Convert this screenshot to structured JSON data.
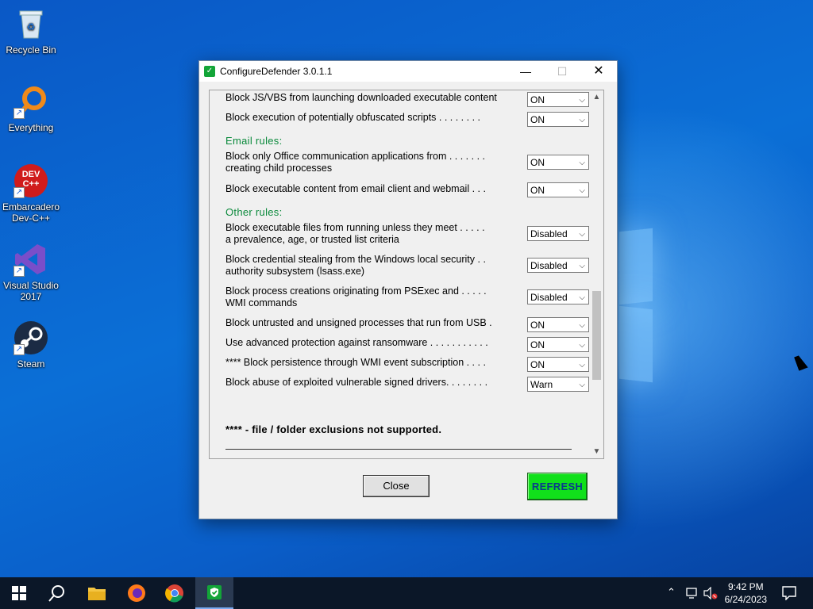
{
  "desktop": {
    "icons": [
      {
        "label": "Recycle Bin"
      },
      {
        "label": "Everything"
      },
      {
        "label": "Embarcadero Dev-C++"
      },
      {
        "label": "Visual Studio 2017"
      },
      {
        "label": "Steam"
      }
    ],
    "dev_cpp_icon_text": "DEV C++"
  },
  "window": {
    "title": "ConfigureDefender 3.0.1.1",
    "rules": [
      {
        "label": "Block JS/VBS from launching downloaded executable content",
        "value": "ON"
      },
      {
        "label": "Block execution of potentially obfuscated scripts . . . . . . . .",
        "value": "ON"
      }
    ],
    "email_section": "Email rules:",
    "email_rules": [
      {
        "label": "Block only Office communication applications from . . . . . . .",
        "label2": "creating child processes",
        "value": "ON"
      },
      {
        "label": "Block executable content from email client and webmail . . .",
        "value": "ON"
      }
    ],
    "other_section": "Other rules:",
    "other_rules": [
      {
        "label": "Block executable files from running unless they meet . . . . .",
        "label2": "a prevalence, age, or trusted list criteria",
        "value": "Disabled"
      },
      {
        "label": "Block credential stealing from the Windows local security . .",
        "label2": "authority subsystem (lsass.exe)",
        "value": "Disabled"
      },
      {
        "label": "Block process creations originating from PSExec and . . . . .",
        "label2": "WMI commands",
        "value": "Disabled"
      },
      {
        "label": "Block untrusted and unsigned processes that run from USB .",
        "value": "ON"
      },
      {
        "label": "Use advanced protection against ransomware . . . . . . . . . . .",
        "value": "ON"
      },
      {
        "label": "**** Block persistence through WMI event subscription . . . .",
        "value": "ON"
      },
      {
        "label": "Block abuse of exploited vulnerable signed drivers. . . . . . . .",
        "value": "Warn"
      }
    ],
    "note": "**** - file / folder exclusions not supported.",
    "close_label": "Close",
    "refresh_label": "REFRESH"
  },
  "taskbar": {
    "time": "9:42 PM",
    "date": "6/24/2023"
  },
  "colors": {
    "section_green": "#0b8a3c",
    "refresh_green": "#11e01b",
    "taskbar": "#0b1728"
  }
}
